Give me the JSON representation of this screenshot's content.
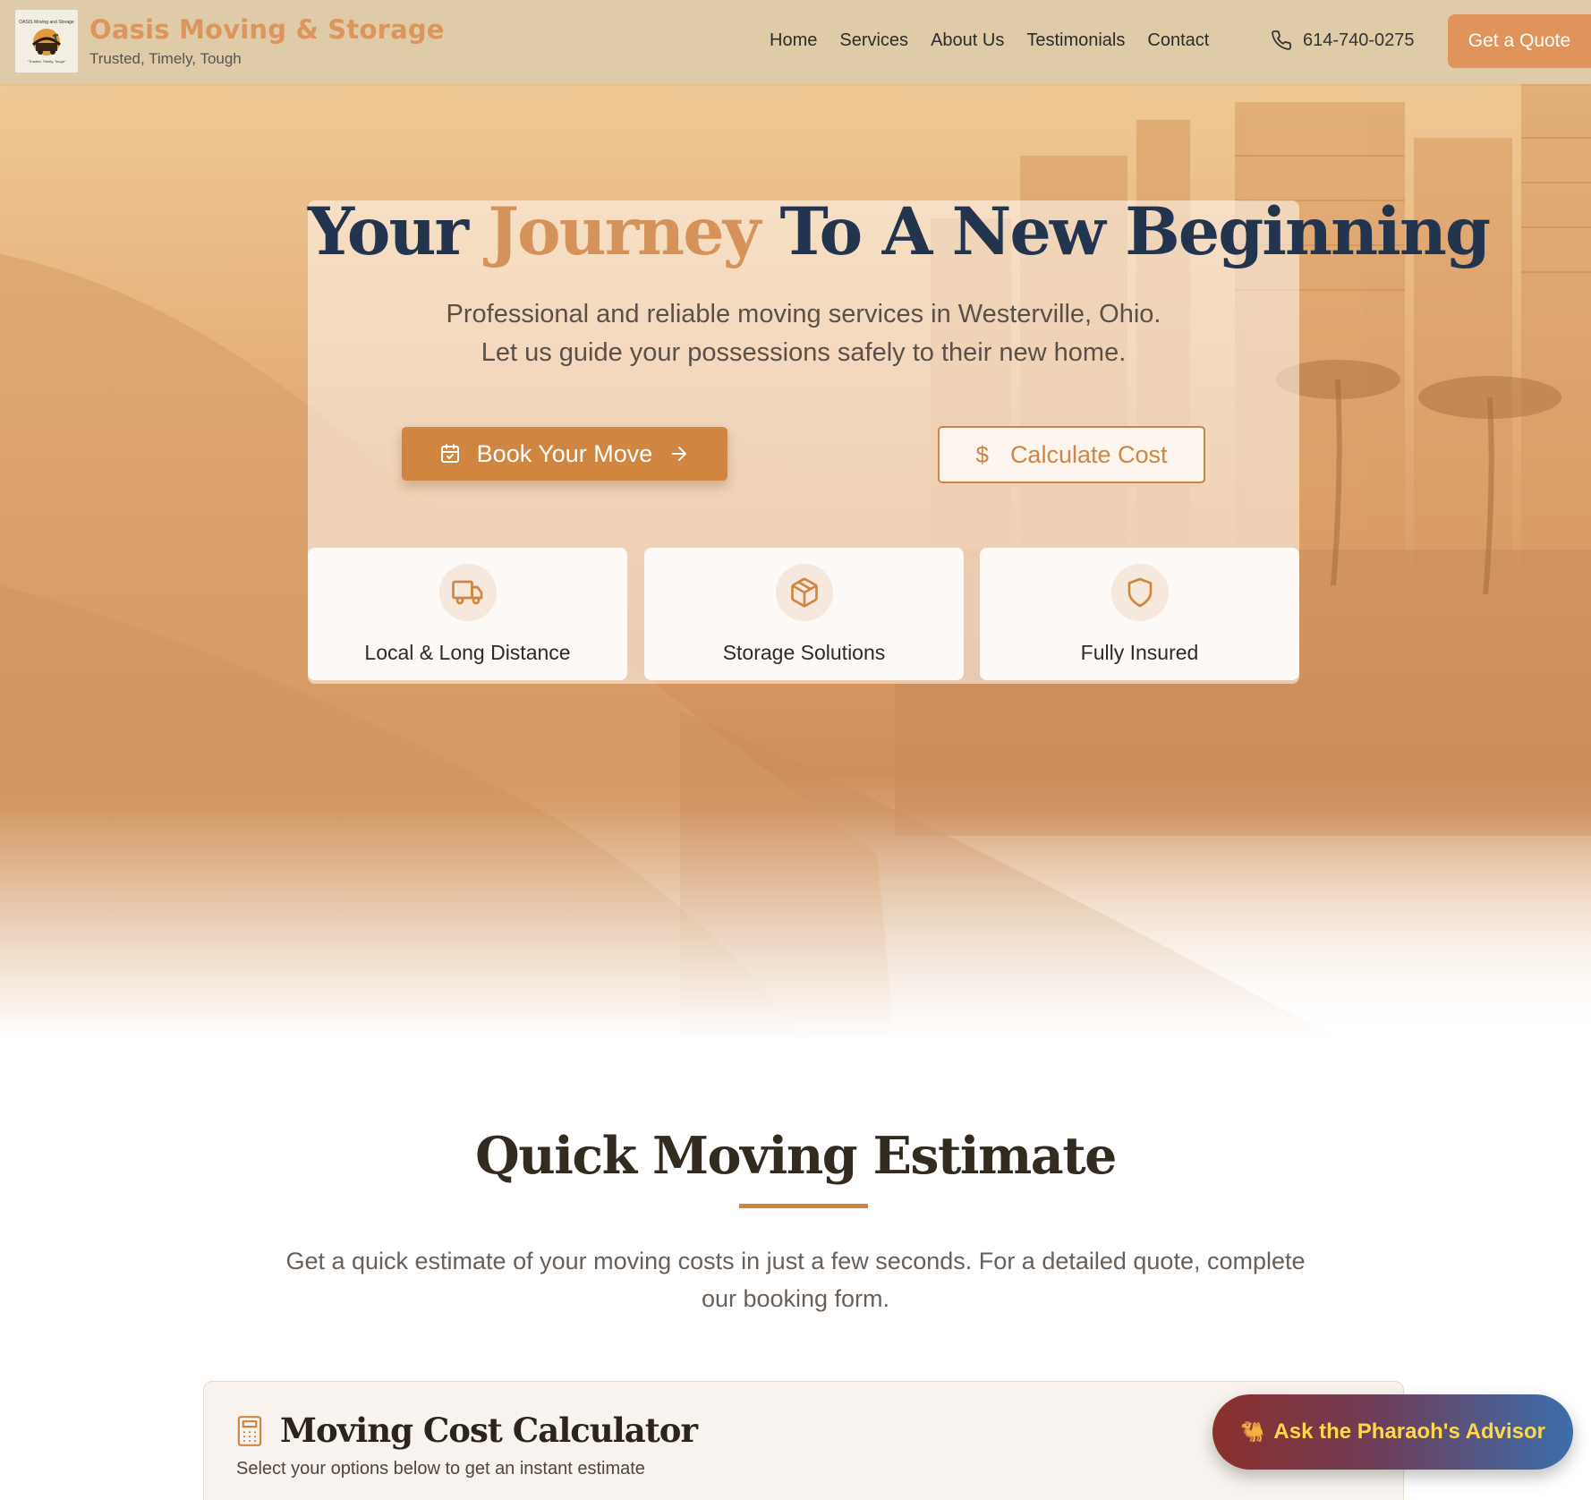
{
  "header": {
    "logo_top": "OASIS Moving and Storage",
    "logo_bottom": "\"Trusted, Timely, Tough\"",
    "brand_name": "Oasis Moving & Storage",
    "brand_tagline": "Trusted, Timely, Tough",
    "nav": [
      "Home",
      "Services",
      "About Us",
      "Testimonials",
      "Contact"
    ],
    "phone": "614-740-0275",
    "quote_button": "Get a Quote"
  },
  "hero": {
    "title_part1": "Your",
    "title_accent": "Journey",
    "title_part2": "To A New Beginning",
    "subtitle_line1": "Professional and reliable moving services in Westerville, Ohio.",
    "subtitle_line2": "Let us guide your possessions safely to their new home.",
    "book_button": "Book Your Move",
    "calc_button": "Calculate Cost",
    "features": [
      {
        "label": "Local & Long Distance",
        "icon": "truck-icon"
      },
      {
        "label": "Storage Solutions",
        "icon": "package-icon"
      },
      {
        "label": "Fully Insured",
        "icon": "shield-icon"
      }
    ]
  },
  "estimate": {
    "title": "Quick Moving Estimate",
    "description": "Get a quick estimate of your moving costs in just a few seconds. For a detailed quote, complete our booking form.",
    "card_title": "Moving Cost Calculator",
    "card_subtitle": "Select your options below to get an instant estimate"
  },
  "advisor": {
    "label": "Ask the Pharaoh's Advisor",
    "icon": "camel-icon"
  },
  "colors": {
    "accent": "#d08640",
    "brand": "#dd955d",
    "navy": "#23344e",
    "header_bg": "#dfcba8"
  }
}
